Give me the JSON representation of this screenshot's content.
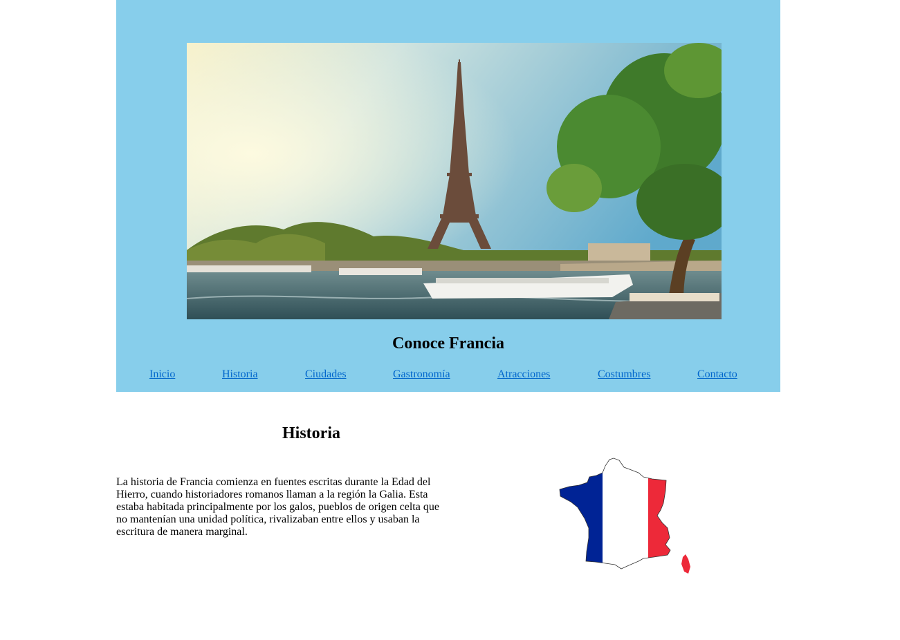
{
  "header": {
    "background_color": "#87CEEB",
    "hero_image": "eiffel-tower-seine-photo",
    "title": "Conoce Francia"
  },
  "nav": {
    "link_color": "#0066CC",
    "items": [
      {
        "label": "Inicio"
      },
      {
        "label": "Historia"
      },
      {
        "label": "Ciudades"
      },
      {
        "label": "Gastronomía"
      },
      {
        "label": "Atracciones"
      },
      {
        "label": "Costumbres"
      },
      {
        "label": "Contacto"
      }
    ]
  },
  "main": {
    "section_title": "Historia",
    "paragraph": "La historia de Francia comienza en fuentes escritas durante la Edad del Hierro, cuando historiadores romanos llaman a la región la Galia. Esta estaba habitada principalmente por los galos, pueblos de origen celta que no mantenían una unidad política, rivalizaban entre ellos y usaban la escritura de manera marginal.",
    "map_image": "france-map-flag",
    "flag_colors": {
      "blue": "#002395",
      "white": "#FFFFFF",
      "red": "#ED2939"
    }
  }
}
